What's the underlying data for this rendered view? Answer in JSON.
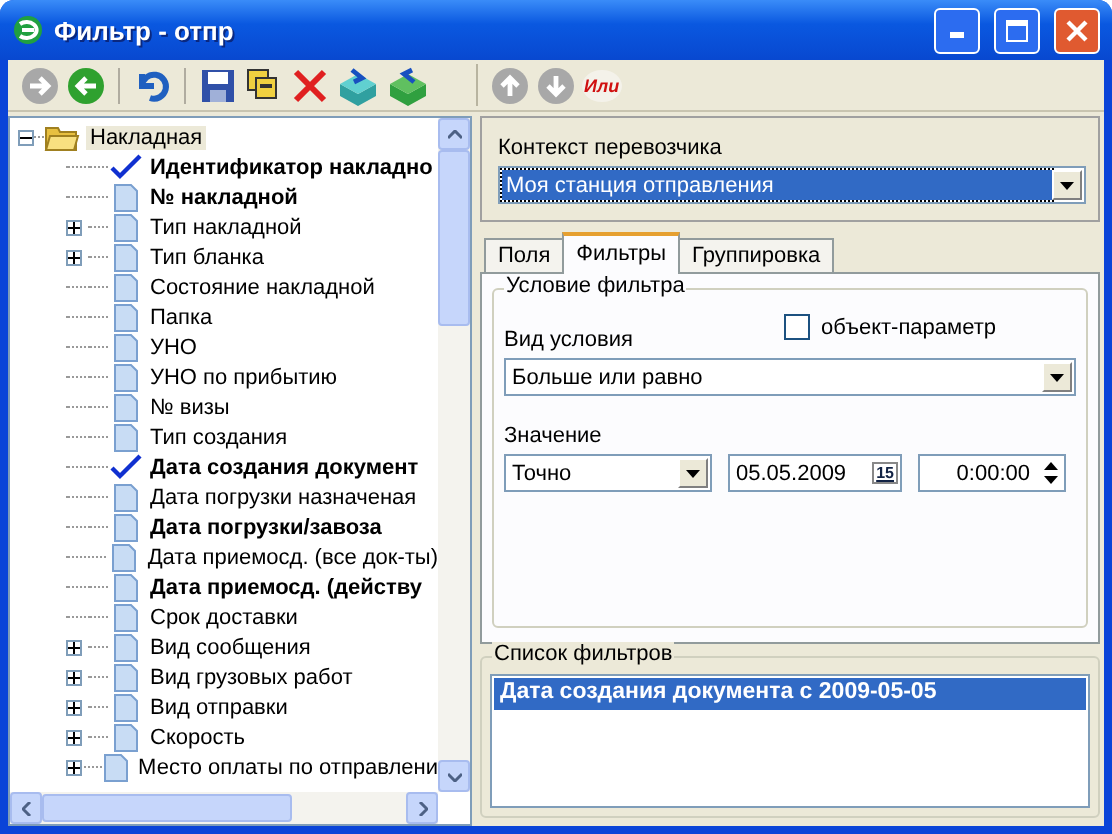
{
  "window": {
    "title": "Фильтр - отпр"
  },
  "toolbar_left": [
    {
      "kind": "forward",
      "disabled": true
    },
    {
      "kind": "back",
      "disabled": false
    },
    {
      "kind": "sep"
    },
    {
      "kind": "undo"
    },
    {
      "kind": "sep"
    },
    {
      "kind": "save"
    },
    {
      "kind": "copy"
    },
    {
      "kind": "delete"
    },
    {
      "kind": "import"
    },
    {
      "kind": "export"
    }
  ],
  "toolbar_right": [
    {
      "kind": "up",
      "disabled": true
    },
    {
      "kind": "down",
      "disabled": true
    },
    {
      "kind": "or",
      "label": "Или"
    }
  ],
  "tree": {
    "label": "Накладная",
    "expanded": true,
    "selected": true,
    "children": [
      {
        "label": "Идентификатор накладно",
        "bold": true,
        "checked": true
      },
      {
        "label": "№ накладной",
        "bold": true,
        "checked": false
      },
      {
        "label": "Тип накладной",
        "bold": false,
        "checked": false,
        "expanded": false
      },
      {
        "label": "Тип бланка",
        "bold": false,
        "checked": false,
        "expanded": false
      },
      {
        "label": "Состояние накладной",
        "bold": false,
        "checked": false
      },
      {
        "label": "Папка",
        "bold": false,
        "checked": false
      },
      {
        "label": "УНО",
        "bold": false,
        "checked": false
      },
      {
        "label": "УНО по прибытию",
        "bold": false,
        "checked": false
      },
      {
        "label": "№ визы",
        "bold": false,
        "checked": false
      },
      {
        "label": "Тип создания",
        "bold": false,
        "checked": false
      },
      {
        "label": "Дата создания документ",
        "bold": true,
        "checked": true
      },
      {
        "label": "Дата погрузки назначеная",
        "bold": false,
        "checked": false
      },
      {
        "label": "Дата погрузки/завоза",
        "bold": true,
        "checked": false
      },
      {
        "label": "Дата приемосд. (все док-ты)",
        "bold": false,
        "checked": false
      },
      {
        "label": "Дата приемосд. (действу",
        "bold": true,
        "checked": false
      },
      {
        "label": "Срок доставки",
        "bold": false,
        "checked": false
      },
      {
        "label": "Вид сообщения",
        "bold": false,
        "checked": false,
        "expanded": false
      },
      {
        "label": "Вид грузовых работ",
        "bold": false,
        "checked": false,
        "expanded": false
      },
      {
        "label": "Вид отправки",
        "bold": false,
        "checked": false,
        "expanded": false
      },
      {
        "label": "Скорость",
        "bold": false,
        "checked": false,
        "expanded": false
      },
      {
        "label": "Место оплаты по отправлени",
        "bold": false,
        "checked": false,
        "expanded": false
      }
    ]
  },
  "carrier_context": {
    "label": "Контекст перевозчика",
    "value": "Моя станция отправления",
    "selected": true
  },
  "tabs": [
    {
      "label": "Поля",
      "selected": false
    },
    {
      "label": "Фильтры",
      "selected": true
    },
    {
      "label": "Группировка",
      "selected": false
    }
  ],
  "filter_condition": {
    "title": "Условие фильтра",
    "condition_label": "Вид условия",
    "object_param": {
      "label": "объект-параметр",
      "checked": false
    },
    "condition_value": "Больше или равно",
    "value_label": "Значение",
    "mode": "Точно",
    "date": "05.05.2009",
    "calendar_button": "15",
    "time": "0:00:00"
  },
  "filter_list": {
    "title": "Список фильтров",
    "items": [
      {
        "label": "Дата создания документа с 2009-05-05",
        "selected": true
      }
    ]
  }
}
